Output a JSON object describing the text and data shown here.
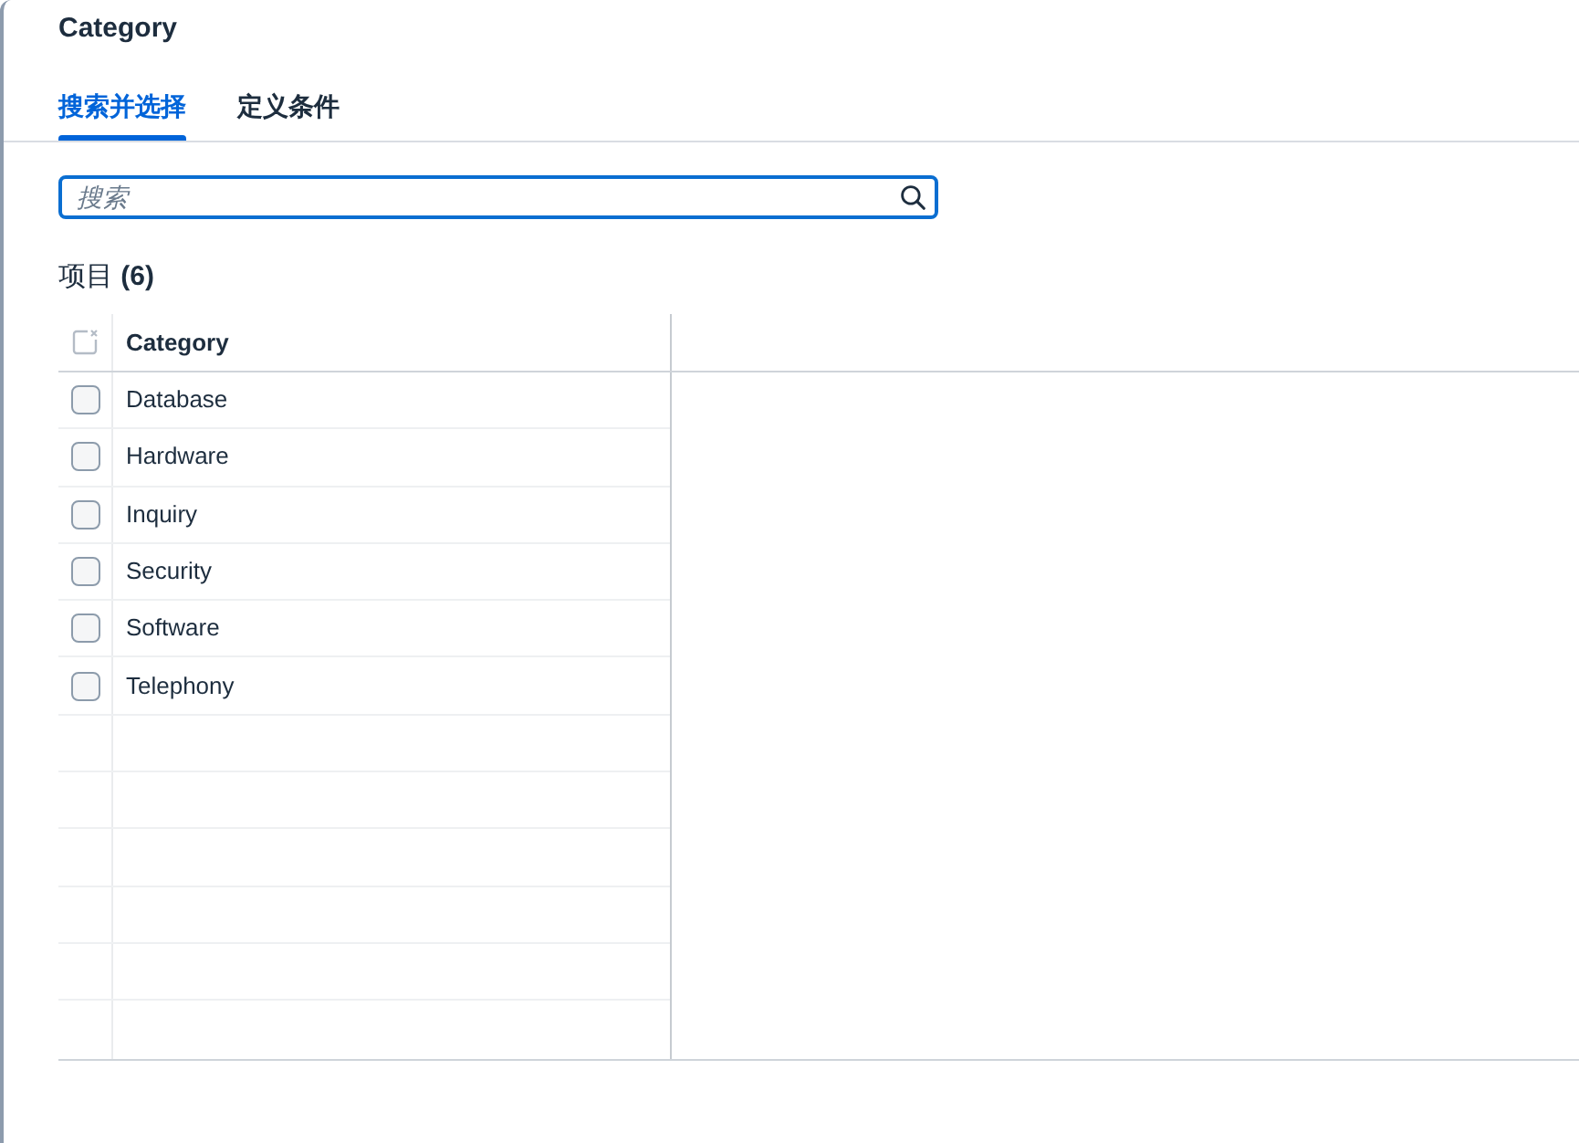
{
  "dialog": {
    "title": "Category"
  },
  "tabs": [
    {
      "label": "搜索并选择",
      "selected": true
    },
    {
      "label": "定义条件",
      "selected": false
    }
  ],
  "search": {
    "placeholder": "搜索",
    "focused": true
  },
  "items_heading": "项目 **(6)**",
  "table": {
    "columns": [
      "Category"
    ],
    "select_all_checked": false,
    "rows": [
      {
        "category": "Database",
        "checked": false
      },
      {
        "category": "Hardware",
        "checked": false
      },
      {
        "category": "Inquiry",
        "checked": false
      },
      {
        "category": "Security",
        "checked": false
      },
      {
        "category": "Software",
        "checked": false
      },
      {
        "category": "Telephony",
        "checked": false
      }
    ]
  }
}
